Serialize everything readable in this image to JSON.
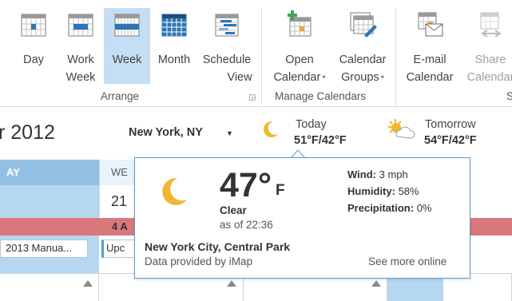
{
  "ribbon": {
    "arrange": {
      "label": "Arrange",
      "buttons": [
        {
          "line1": "Day",
          "line2": ""
        },
        {
          "line1": "Work",
          "line2": "Week"
        },
        {
          "line1": "Week",
          "line2": ""
        },
        {
          "line1": "Month",
          "line2": ""
        },
        {
          "line1": "Schedule",
          "line2": "View"
        }
      ]
    },
    "manage": {
      "label": "Manage Calendars",
      "buttons": [
        {
          "line1": "Open",
          "line2": "Calendar"
        },
        {
          "line1": "Calendar",
          "line2": "Groups"
        }
      ]
    },
    "share": {
      "label": "S",
      "buttons": [
        {
          "line1": "E-mail",
          "line2": "Calendar"
        },
        {
          "line1": "Share",
          "line2": "Calendar"
        }
      ]
    },
    "accent": "#c5def4"
  },
  "datebar": {
    "date_text": "r 2012",
    "location": "New York, NY",
    "today_label": "Today",
    "today_temps": "51°F/42°F",
    "tomorrow_label": "Tomorrow",
    "tomorrow_temps": "54°F/42°F"
  },
  "calendar": {
    "day_header": "AY",
    "wed_header": "WE",
    "date_number": "21",
    "holiday_text": "4 A",
    "appt1": "2013 Manua...",
    "appt2": "Upc"
  },
  "popup": {
    "temperature": "47°",
    "unit": "F",
    "condition": "Clear",
    "as_of": "as of 22:36",
    "wind_label": "Wind:",
    "wind_value": "3 mph",
    "humidity_label": "Humidity:",
    "humidity_value": "58%",
    "precip_label": "Precipitation:",
    "precip_value": "0%",
    "location": "New York City, Central Park",
    "provider": "Data provided by iMap",
    "see_more": "See more online"
  },
  "icons": [
    "day-view-icon",
    "work-week-view-icon",
    "week-view-icon",
    "month-view-icon",
    "schedule-view-icon",
    "open-calendar-icon",
    "calendar-groups-icon",
    "email-calendar-icon",
    "share-calendar-icon",
    "moon-icon",
    "sun-cloud-icon",
    "dialog-launcher-icon"
  ]
}
